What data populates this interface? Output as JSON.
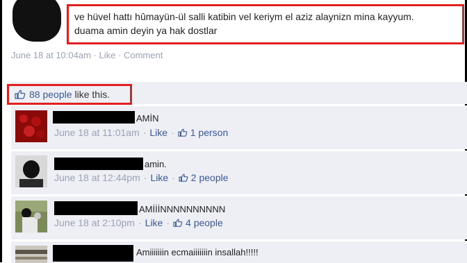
{
  "post": {
    "text_line1": "ve hüvel hattı hûmayün-ül salli katibin vel keriym el aziz alaynizn mina kayyum.",
    "text_line2": "duama amin deyin ya hak dostlar",
    "timestamp": "June 18 at 10:04am",
    "like_label": "Like",
    "comment_label": "Comment",
    "separator": "·"
  },
  "likes": {
    "count_text": "88 people",
    "suffix": "like this."
  },
  "comments": [
    {
      "text": "AMİN",
      "time": "June 18 at 11:01am",
      "like_label": "Like",
      "people": "1 person"
    },
    {
      "text": "amin.",
      "time": "June 18 at 12:44pm",
      "like_label": "Like",
      "people": "2 people"
    },
    {
      "text": "AMİİİNNNNNNNNNN",
      "time": "June 18 at 2:10pm",
      "like_label": "Like",
      "people": "4 people"
    },
    {
      "text": "Amiiiiiiin ecmaiiiiiiin insallah!!!!!"
    }
  ],
  "colors": {
    "highlight_border": "#e02020",
    "link": "#3b5998",
    "meta_text": "#9aa3b5",
    "comment_bg": "#edeff4"
  },
  "icons": {
    "like": "thumbs-up-icon"
  }
}
